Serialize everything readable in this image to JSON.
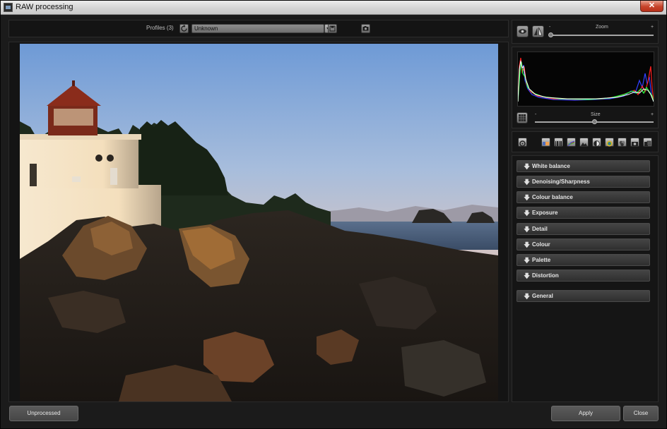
{
  "window": {
    "title": "RAW processing",
    "close_glyph": "✕"
  },
  "toolbar": {
    "profiles_label": "Profiles (3)",
    "reload_icon": "refresh-icon",
    "profile_value": "Unknown",
    "save_icon": "save-icon",
    "camera_icon": "camera-icon"
  },
  "view": {
    "zoom_label": "Zoom",
    "zoom_min": "-",
    "zoom_max": "+",
    "zoom_level": 0.0,
    "size_label": "Size",
    "size_min": "-",
    "size_max": "+",
    "size_level": 0.5
  },
  "histogram": {
    "channels": [
      "red",
      "green",
      "blue",
      "white"
    ],
    "colors": {
      "red": "#ff2020",
      "green": "#20ff40",
      "blue": "#3040ff",
      "white": "#ffffff"
    }
  },
  "tools": [
    "gear-icon",
    "gradient-icon",
    "barcode-icon",
    "curves-icon",
    "landscape-icon",
    "contrast-icon",
    "color-wheel-icon",
    "color-spheres-icon",
    "camera-lens-icon",
    "compare-icon"
  ],
  "sections": [
    {
      "label": "White balance"
    },
    {
      "label": "Denoising/Sharpness"
    },
    {
      "label": "Colour balance"
    },
    {
      "label": "Exposure"
    },
    {
      "label": "Detail"
    },
    {
      "label": "Colour"
    },
    {
      "label": "Palette"
    },
    {
      "label": "Distortion"
    },
    {
      "label": "General"
    }
  ],
  "section_arrow": "🡇",
  "buttons": {
    "unprocessed": "Unprocessed",
    "apply": "Apply",
    "close": "Close"
  }
}
